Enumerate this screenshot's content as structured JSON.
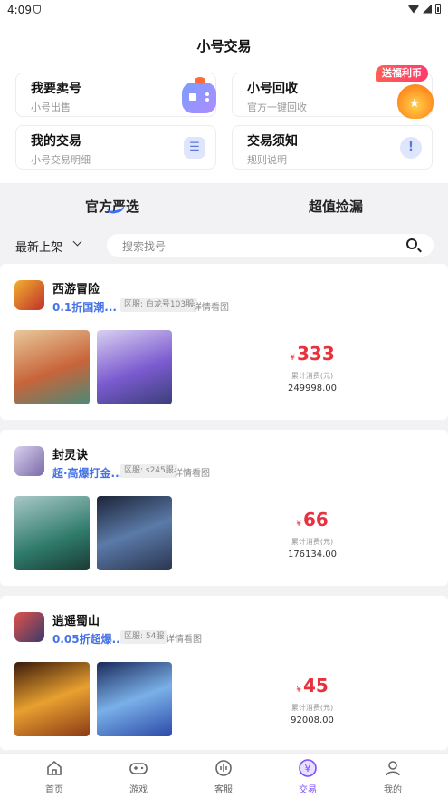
{
  "status": {
    "time": "4:09"
  },
  "header": {
    "title": "小号交易"
  },
  "cards": [
    {
      "title": "我要卖号",
      "subtitle": "小号出售",
      "icon": "gamepad-icon"
    },
    {
      "title": "小号回收",
      "subtitle": "官方一键回收",
      "badge": "送福利币",
      "icon": "coin-bag-icon"
    },
    {
      "title": "我的交易",
      "subtitle": "小号交易明细",
      "icon": "list-icon"
    },
    {
      "title": "交易须知",
      "subtitle": "规则说明",
      "icon": "info-icon"
    }
  ],
  "tabs": [
    "官方严选",
    "超值捡漏"
  ],
  "filter": {
    "sort": "最新上架",
    "search_placeholder": "搜索找号"
  },
  "listings": [
    {
      "name": "西游冒险",
      "desc": "0.1折国潮...",
      "server": "区服: 白龙号103服",
      "see": "详情看图",
      "price": "333",
      "price_label": "累计消费(元)",
      "spent": "249998.00",
      "colors": [
        "#c8643a",
        "#7c5bd0"
      ]
    },
    {
      "name": "封灵诀",
      "desc": "超·高爆打金...",
      "server": "区服: s245服",
      "see": "详情看图",
      "price": "66",
      "price_label": "累计消费(元)",
      "spent": "176134.00",
      "colors": [
        "#2e7a6a",
        "#2b3550"
      ]
    },
    {
      "name": "逍遥蜀山",
      "desc": "0.05折超爆...",
      "server": "区服: 54服",
      "see": "详情看图",
      "price": "45",
      "price_label": "累计消费(元)",
      "spent": "92008.00",
      "colors": [
        "#8a3b16",
        "#2c4aa8"
      ]
    }
  ],
  "nav": [
    "首页",
    "游戏",
    "客服",
    "交易",
    "我的"
  ],
  "accent": "#4572e6",
  "price_color": "#e8313d"
}
